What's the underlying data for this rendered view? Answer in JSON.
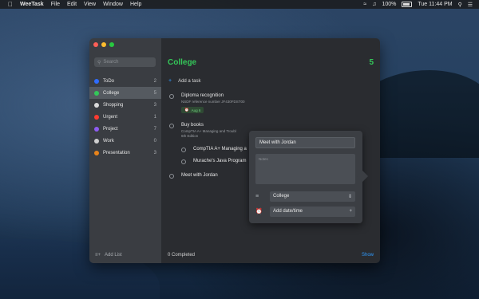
{
  "menubar": {
    "app_name": "WeeTask",
    "menus": [
      "File",
      "Edit",
      "View",
      "Window",
      "Help"
    ],
    "battery": "100%",
    "clock": "Tue 11:44 PM"
  },
  "sidebar": {
    "search_placeholder": "Search",
    "lists": [
      {
        "label": "ToDo",
        "count": "2",
        "color": "#2f6cff"
      },
      {
        "label": "College",
        "count": "5",
        "color": "#34c759"
      },
      {
        "label": "Shopping",
        "count": "3",
        "color": "#d9d9d9"
      },
      {
        "label": "Urgent",
        "count": "1",
        "color": "#ff3b30"
      },
      {
        "label": "Project",
        "count": "7",
        "color": "#8e5cf0"
      },
      {
        "label": "Work",
        "count": "0",
        "color": "#cfcfcf"
      },
      {
        "label": "Presentation",
        "count": "3",
        "color": "#e8831a"
      }
    ],
    "add_list_label": "Add List"
  },
  "main": {
    "title": "College",
    "count": "5",
    "add_task_label": "Add a task",
    "tasks": [
      {
        "title": "Diploma recognition",
        "subtitle": "NSDF reference number JF430FDST00",
        "tag": "Aug 6"
      },
      {
        "title": "Buy books",
        "subtitle_1": "CompTIA A+ Managing and Troubl",
        "subtitle_2": "6th Edition"
      },
      {
        "title": "CompTIA A+ Managing a"
      },
      {
        "title": "Murache's Java Program"
      },
      {
        "title": "Meet with Jordan"
      }
    ],
    "completed_label": "0 Completed",
    "show_label": "Show"
  },
  "popover": {
    "title_value": "Meet with Jordan",
    "notes_placeholder": "Notes",
    "list_value": "College",
    "date_label": "Add date/time"
  }
}
